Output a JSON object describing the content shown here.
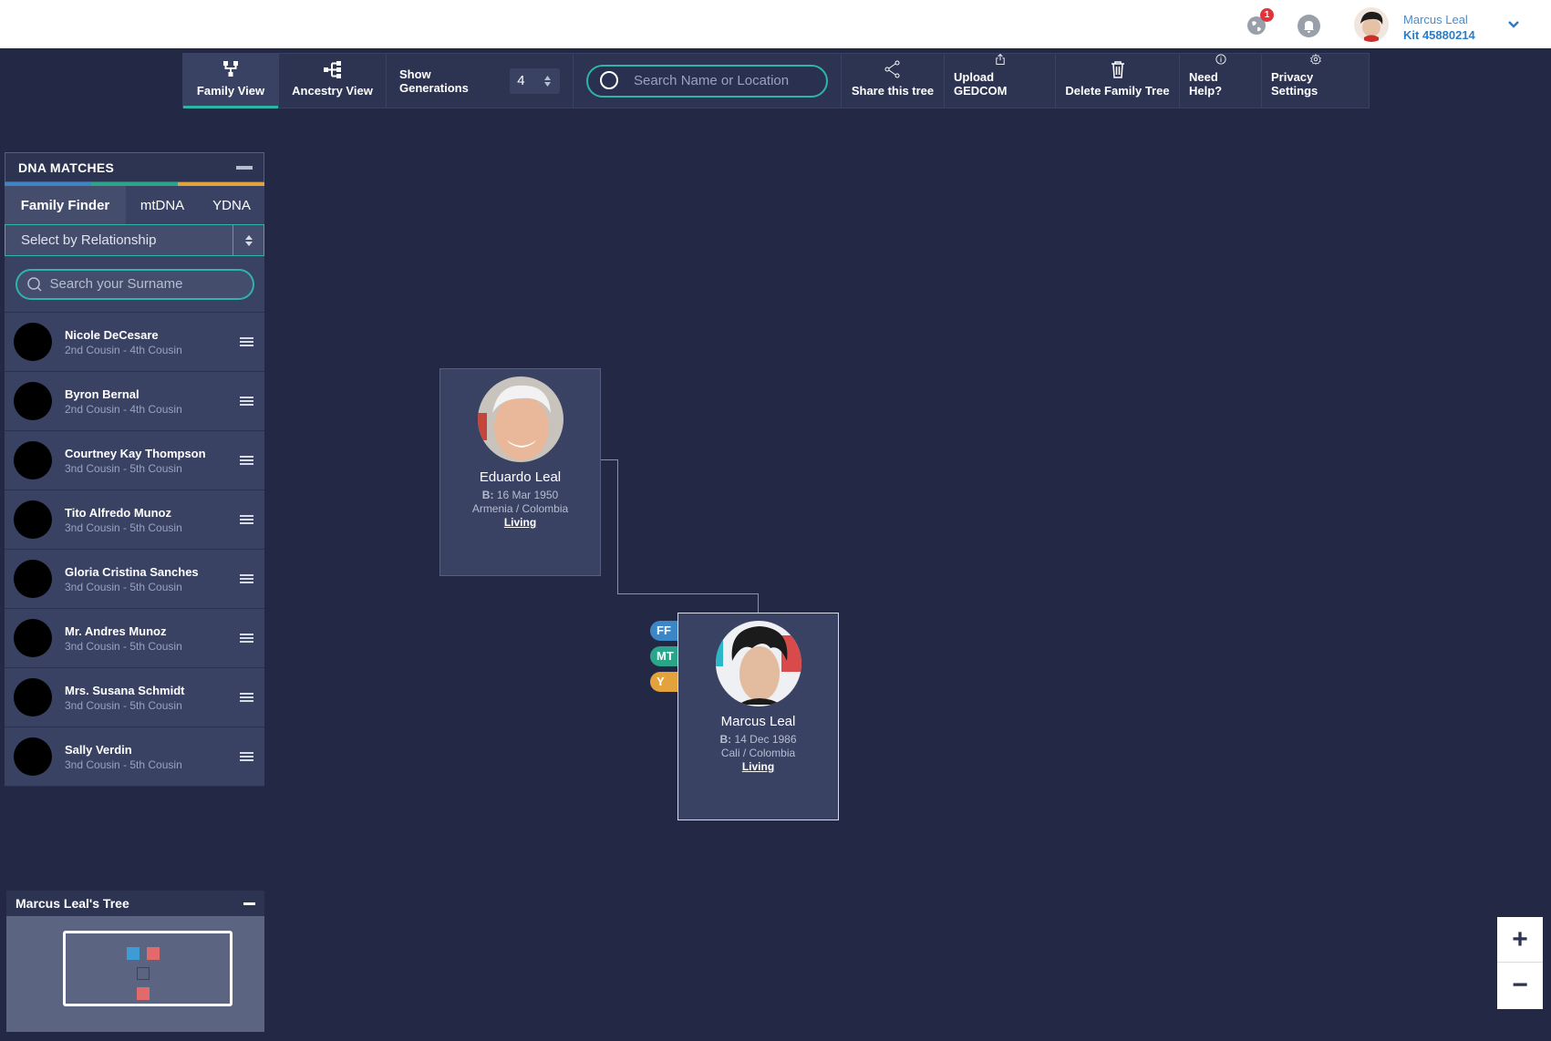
{
  "header": {
    "notification_count": "1",
    "user_name": "Marcus Leal",
    "kit": "Kit 45880214"
  },
  "toolbar": {
    "family_view": "Family View",
    "ancestry_view": "Ancestry View",
    "show_generations_label": "Show Generations",
    "generations_value": "4",
    "search_placeholder": "Search Name or Location",
    "share": "Share this tree",
    "upload": "Upload GEDCOM",
    "delete": "Delete Family Tree",
    "help": "Need Help?",
    "privacy": "Privacy Settings"
  },
  "dna": {
    "title": "DNA MATCHES",
    "tabs": [
      "Family Finder",
      "mtDNA",
      "YDNA"
    ],
    "select_label": "Select by Relationship",
    "search_placeholder": "Search your Surname",
    "matches": [
      {
        "name": "Nicole DeCesare",
        "relation": "2nd Cousin - 4th Cousin"
      },
      {
        "name": "Byron Bernal",
        "relation": "2nd Cousin - 4th Cousin"
      },
      {
        "name": "Courtney Kay Thompson",
        "relation": "3nd Cousin - 5th Cousin"
      },
      {
        "name": "Tito Alfredo Munoz",
        "relation": "3nd Cousin - 5th Cousin"
      },
      {
        "name": "Gloria Cristina Sanches",
        "relation": "3nd Cousin - 5th Cousin"
      },
      {
        "name": "Mr. Andres Munoz",
        "relation": "3nd Cousin - 5th Cousin"
      },
      {
        "name": "Mrs. Susana Schmidt",
        "relation": "3nd Cousin - 5th Cousin"
      },
      {
        "name": "Sally Verdin",
        "relation": "3nd Cousin - 5th Cousin"
      }
    ]
  },
  "tree": {
    "father": {
      "name": "Eduardo Leal",
      "birth_label": "B:",
      "birth": "16 Mar 1950",
      "place": "Armenia / Colombia",
      "status": "Living"
    },
    "self": {
      "name": "Marcus Leal",
      "birth_label": "B:",
      "birth": "14 Dec 1986",
      "place": "Cali / Colombia",
      "status": "Living"
    },
    "tags": [
      "FF",
      "MT",
      "Y"
    ]
  },
  "mini_tree": {
    "title": "Marcus Leal's Tree"
  },
  "zoom": {
    "in": "+",
    "out": "−"
  },
  "colors": {
    "accent": "#2fb4a8",
    "ff": "#3d86c6",
    "mt": "#2aa58a",
    "y": "#e4a23c",
    "male": "#3d9bd6",
    "female": "#e36a6a"
  }
}
